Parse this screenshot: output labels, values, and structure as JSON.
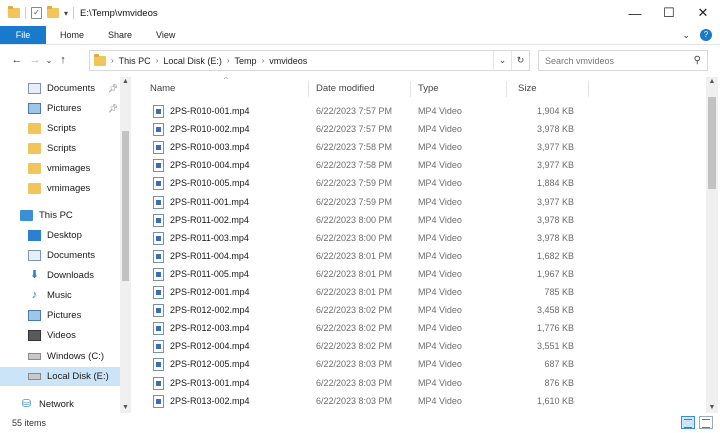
{
  "window": {
    "title": "E:\\Temp\\vmvideos",
    "controls": {
      "minimize": "—",
      "maximize": "☐",
      "close": "✕"
    }
  },
  "ribbon": {
    "file_tab": "File",
    "tabs": [
      "Home",
      "Share",
      "View"
    ],
    "help": "?"
  },
  "address": {
    "crumbs": [
      "This PC",
      "Local Disk (E:)",
      "Temp",
      "vmvideos"
    ]
  },
  "search": {
    "placeholder": "Search vmvideos"
  },
  "sidebar": {
    "items": [
      {
        "label": "Documents",
        "icon": "documents-icon",
        "pinned": true
      },
      {
        "label": "Pictures",
        "icon": "pictures-icon",
        "pinned": true
      },
      {
        "label": "Scripts",
        "icon": "folder-icon"
      },
      {
        "label": "Scripts",
        "icon": "folder-icon"
      },
      {
        "label": "vmimages",
        "icon": "folder-icon"
      },
      {
        "label": "vmimages",
        "icon": "folder-icon"
      },
      {
        "label": "This PC",
        "icon": "pc-icon"
      },
      {
        "label": "Desktop",
        "icon": "desktop-icon"
      },
      {
        "label": "Documents",
        "icon": "documents-icon"
      },
      {
        "label": "Downloads",
        "icon": "downloads-icon"
      },
      {
        "label": "Music",
        "icon": "music-icon"
      },
      {
        "label": "Pictures",
        "icon": "pictures-icon"
      },
      {
        "label": "Videos",
        "icon": "videos-icon"
      },
      {
        "label": "Windows (C:)",
        "icon": "drive-icon"
      },
      {
        "label": "Local Disk (E:)",
        "icon": "drive-icon",
        "selected": true
      },
      {
        "label": "Network",
        "icon": "network-icon"
      }
    ]
  },
  "columns": {
    "name": "Name",
    "date": "Date modified",
    "type": "Type",
    "size": "Size"
  },
  "files": [
    {
      "name": "2PS-R010-001.mp4",
      "date": "6/22/2023 7:57 PM",
      "type": "MP4 Video",
      "size": "1,904 KB"
    },
    {
      "name": "2PS-R010-002.mp4",
      "date": "6/22/2023 7:57 PM",
      "type": "MP4 Video",
      "size": "3,978 KB"
    },
    {
      "name": "2PS-R010-003.mp4",
      "date": "6/22/2023 7:58 PM",
      "type": "MP4 Video",
      "size": "3,977 KB"
    },
    {
      "name": "2PS-R010-004.mp4",
      "date": "6/22/2023 7:58 PM",
      "type": "MP4 Video",
      "size": "3,977 KB"
    },
    {
      "name": "2PS-R010-005.mp4",
      "date": "6/22/2023 7:59 PM",
      "type": "MP4 Video",
      "size": "1,884 KB"
    },
    {
      "name": "2PS-R011-001.mp4",
      "date": "6/22/2023 7:59 PM",
      "type": "MP4 Video",
      "size": "3,977 KB"
    },
    {
      "name": "2PS-R011-002.mp4",
      "date": "6/22/2023 8:00 PM",
      "type": "MP4 Video",
      "size": "3,978 KB"
    },
    {
      "name": "2PS-R011-003.mp4",
      "date": "6/22/2023 8:00 PM",
      "type": "MP4 Video",
      "size": "3,978 KB"
    },
    {
      "name": "2PS-R011-004.mp4",
      "date": "6/22/2023 8:01 PM",
      "type": "MP4 Video",
      "size": "1,682 KB"
    },
    {
      "name": "2PS-R011-005.mp4",
      "date": "6/22/2023 8:01 PM",
      "type": "MP4 Video",
      "size": "1,967 KB"
    },
    {
      "name": "2PS-R012-001.mp4",
      "date": "6/22/2023 8:01 PM",
      "type": "MP4 Video",
      "size": "785 KB"
    },
    {
      "name": "2PS-R012-002.mp4",
      "date": "6/22/2023 8:02 PM",
      "type": "MP4 Video",
      "size": "3,458 KB"
    },
    {
      "name": "2PS-R012-003.mp4",
      "date": "6/22/2023 8:02 PM",
      "type": "MP4 Video",
      "size": "1,776 KB"
    },
    {
      "name": "2PS-R012-004.mp4",
      "date": "6/22/2023 8:02 PM",
      "type": "MP4 Video",
      "size": "3,551 KB"
    },
    {
      "name": "2PS-R012-005.mp4",
      "date": "6/22/2023 8:03 PM",
      "type": "MP4 Video",
      "size": "687 KB"
    },
    {
      "name": "2PS-R013-001.mp4",
      "date": "6/22/2023 8:03 PM",
      "type": "MP4 Video",
      "size": "876 KB"
    },
    {
      "name": "2PS-R013-002.mp4",
      "date": "6/22/2023 8:03 PM",
      "type": "MP4 Video",
      "size": "1,610 KB"
    }
  ],
  "status": {
    "item_count": "55 items"
  },
  "colors": {
    "accent": "#1979ca",
    "selected_bg": "#cce4f7",
    "folder": "#f2c55c"
  }
}
